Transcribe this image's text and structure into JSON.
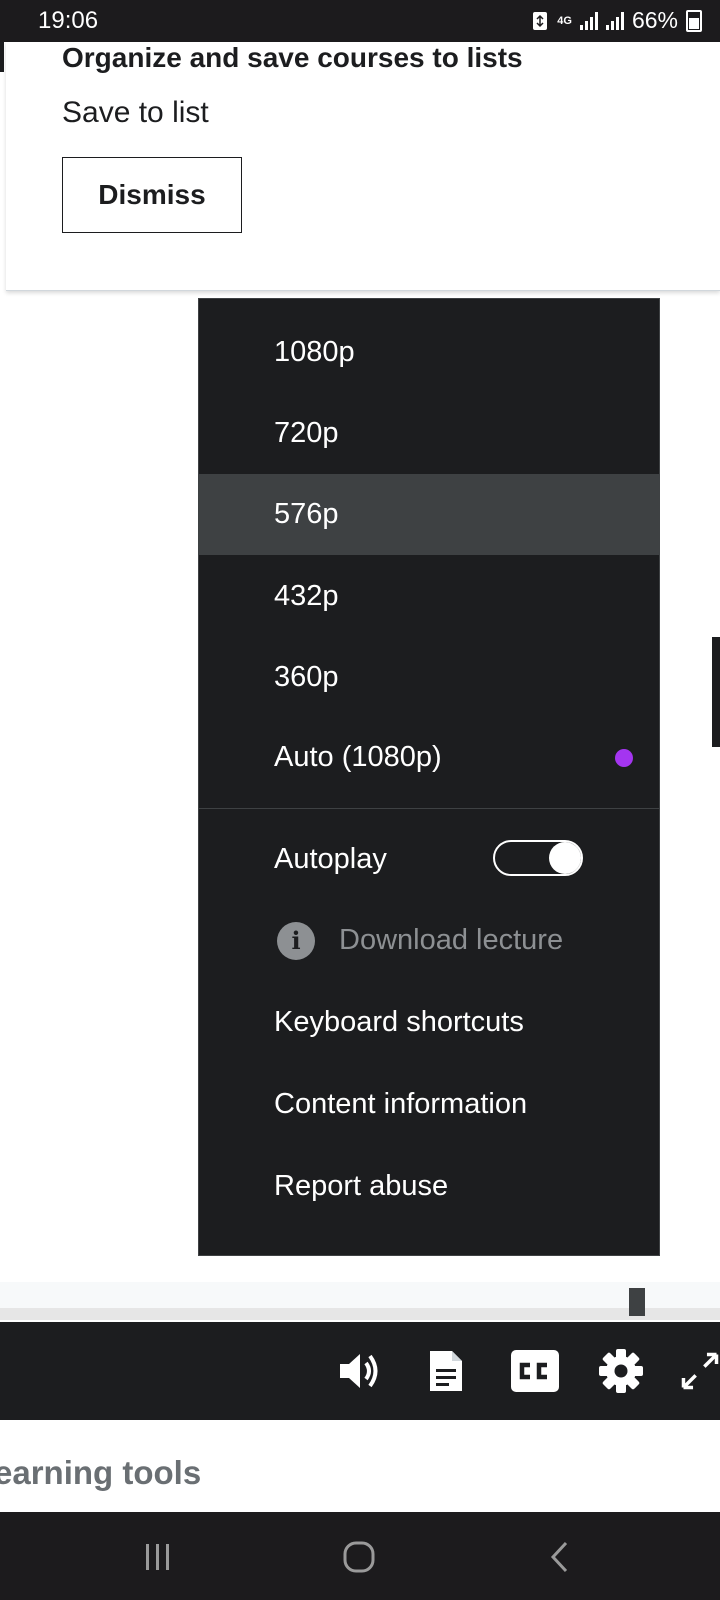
{
  "status_bar": {
    "time": "19:06",
    "network": "4G",
    "battery": "66%"
  },
  "popup": {
    "title": "Organize and save courses to lists",
    "subtitle": "Save to list",
    "dismiss_label": "Dismiss"
  },
  "menu": {
    "qualities": [
      {
        "label": "1080p",
        "selected": false
      },
      {
        "label": "720p",
        "selected": false
      },
      {
        "label": "576p",
        "selected": true
      },
      {
        "label": "432p",
        "selected": false
      },
      {
        "label": "360p",
        "selected": false
      },
      {
        "label": "Auto (1080p)",
        "current": true
      }
    ],
    "current_indicator_color": "#a435f0",
    "autoplay_label": "Autoplay",
    "autoplay_on": true,
    "download_label": "Download lecture",
    "keyboard_label": "Keyboard shortcuts",
    "content_info_label": "Content information",
    "report_label": "Report abuse"
  },
  "controls": {
    "icons": [
      "volume-icon",
      "transcript-icon",
      "captions-icon",
      "settings-icon",
      "fullscreen-icon"
    ]
  },
  "learning_tools": {
    "label": "earning tools"
  }
}
